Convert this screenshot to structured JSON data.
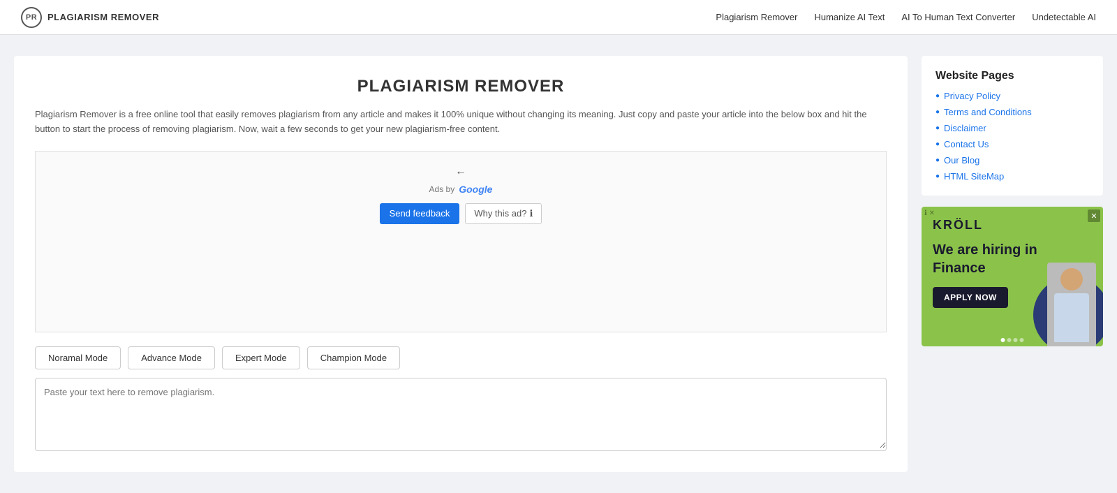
{
  "header": {
    "logo_text": "PR",
    "brand_name": "PLAGIARISM REMOVER",
    "nav": [
      {
        "label": "Plagiarism Remover",
        "href": "#"
      },
      {
        "label": "Humanize AI Text",
        "href": "#"
      },
      {
        "label": "AI To Human Text Converter",
        "href": "#"
      },
      {
        "label": "Undetectable AI",
        "href": "#"
      }
    ]
  },
  "main": {
    "title": "PLAGIARISM REMOVER",
    "description": "Plagiarism Remover is a free online tool that easily removes plagiarism from any article and makes it 100% unique without changing its meaning. Just copy and paste your article into the below box and hit the button to start the process of removing plagiarism. Now, wait a few seconds to get your new plagiarism-free content.",
    "ad": {
      "ads_by_label": "Ads by",
      "google_label": "Google",
      "send_feedback_label": "Send feedback",
      "why_ad_label": "Why this ad?"
    },
    "modes": [
      {
        "label": "Noramal Mode",
        "key": "normal"
      },
      {
        "label": "Advance Mode",
        "key": "advance"
      },
      {
        "label": "Expert Mode",
        "key": "expert"
      },
      {
        "label": "Champion Mode",
        "key": "champion"
      }
    ],
    "textarea_placeholder": "Paste your text here to remove plagiarism."
  },
  "sidebar": {
    "pages_title": "Website Pages",
    "links": [
      {
        "label": "Privacy Policy",
        "href": "#"
      },
      {
        "label": "Terms and Conditions",
        "href": "#"
      },
      {
        "label": "Disclaimer",
        "href": "#"
      },
      {
        "label": "Contact Us",
        "href": "#"
      },
      {
        "label": "Our Blog",
        "href": "#"
      },
      {
        "label": "HTML SiteMap",
        "href": "#"
      }
    ],
    "ad": {
      "logo": "KRÖLL",
      "headline_line1": "We are hiring in",
      "headline_line2": "Finance",
      "cta": "APPLY NOW"
    }
  }
}
